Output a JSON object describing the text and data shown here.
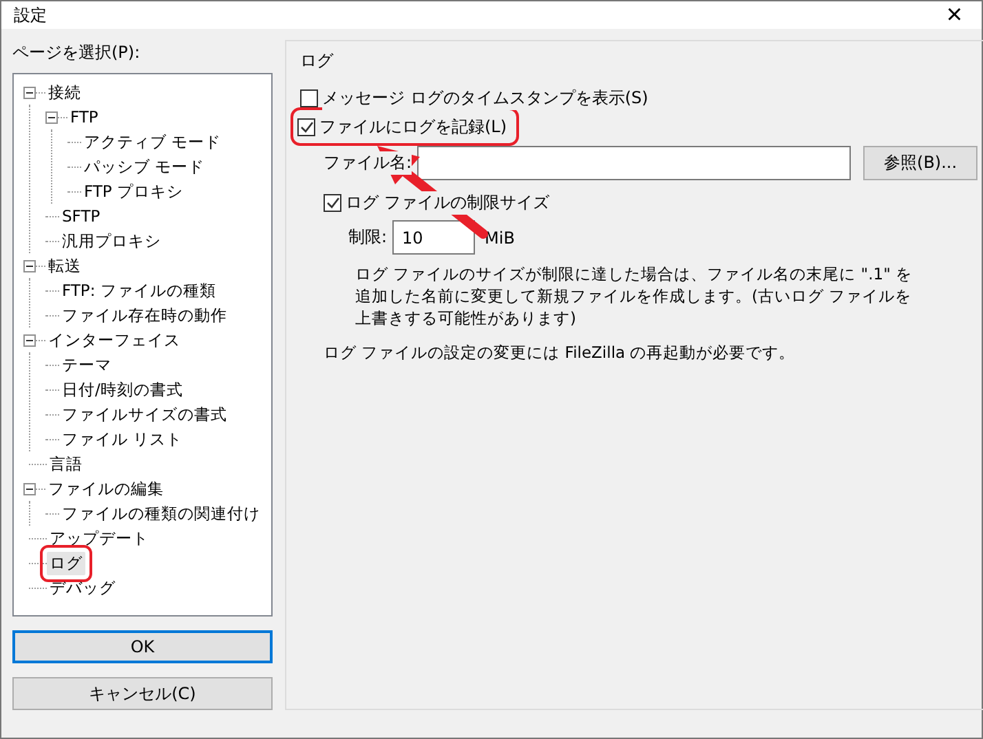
{
  "window": {
    "title": "設定",
    "close": "×"
  },
  "sidebar": {
    "label": "ページを選択(P):",
    "tree": [
      {
        "label": "接続",
        "expanded": true,
        "selected": false,
        "annotated": false,
        "children": [
          {
            "label": "FTP",
            "expanded": true,
            "selected": false,
            "annotated": false,
            "children": [
              {
                "label": "アクティブ モード",
                "selected": false,
                "annotated": false
              },
              {
                "label": "パッシブ モード",
                "selected": false,
                "annotated": false
              },
              {
                "label": "FTP プロキシ",
                "selected": false,
                "annotated": false
              }
            ]
          },
          {
            "label": "SFTP",
            "selected": false,
            "annotated": false
          },
          {
            "label": "汎用プロキシ",
            "selected": false,
            "annotated": false
          }
        ]
      },
      {
        "label": "転送",
        "expanded": true,
        "selected": false,
        "annotated": false,
        "children": [
          {
            "label": "FTP: ファイルの種類",
            "selected": false,
            "annotated": false
          },
          {
            "label": "ファイル存在時の動作",
            "selected": false,
            "annotated": false
          }
        ]
      },
      {
        "label": "インターフェイス",
        "expanded": true,
        "selected": false,
        "annotated": false,
        "children": [
          {
            "label": "テーマ",
            "selected": false,
            "annotated": false
          },
          {
            "label": "日付/時刻の書式",
            "selected": false,
            "annotated": false
          },
          {
            "label": "ファイルサイズの書式",
            "selected": false,
            "annotated": false
          },
          {
            "label": "ファイル リスト",
            "selected": false,
            "annotated": false
          }
        ]
      },
      {
        "label": "言語",
        "selected": false,
        "annotated": false
      },
      {
        "label": "ファイルの編集",
        "expanded": true,
        "selected": false,
        "annotated": false,
        "children": [
          {
            "label": "ファイルの種類の関連付け",
            "selected": false,
            "annotated": false
          }
        ]
      },
      {
        "label": "アップデート",
        "selected": false,
        "annotated": false
      },
      {
        "label": "ログ",
        "selected": true,
        "annotated": true
      },
      {
        "label": "デバッグ",
        "selected": false,
        "annotated": false
      }
    ]
  },
  "buttons": [
    {
      "label": "OK",
      "default": true
    },
    {
      "label": "キャンセル(C)",
      "default": false
    }
  ],
  "log_group": {
    "title": "ログ",
    "timestamp_checkbox": {
      "label": "メッセージ ログのタイムスタンプを表示(S)",
      "checked": false,
      "annotated": false
    },
    "file_checkbox": {
      "label": "ファイルにログを記録(L)",
      "checked": true,
      "annotated": true
    },
    "filename": {
      "label": "ファイル名:",
      "browse": "参照(B)..."
    },
    "limit_checkbox": {
      "label": "ログ ファイルの制限サイズ",
      "checked": true,
      "annotated": false
    },
    "limit": {
      "label": "制限:",
      "value": "10",
      "unit": "MiB"
    },
    "description": "ログ ファイルのサイズが制限に達した場合は、ファイル名の末尾に \".1\" を追加した名前に変更して新規ファイルを作成します。(古いログ ファイルを上書きする可能性があります)",
    "note": "ログ ファイルの設定の変更には FileZilla の再起動が必要です。"
  }
}
